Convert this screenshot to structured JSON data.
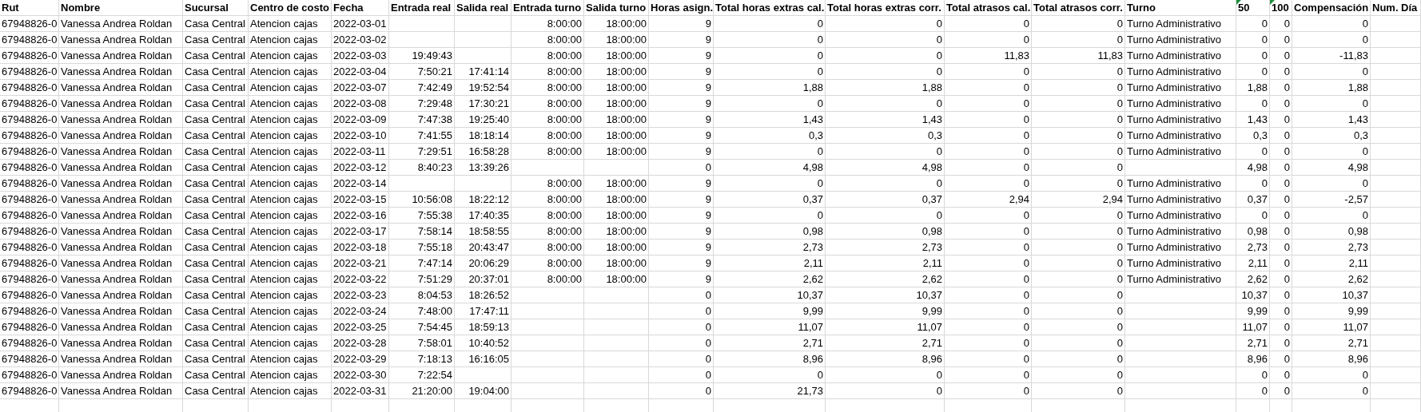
{
  "table": {
    "columns": [
      {
        "label": "Rut",
        "kind": "text"
      },
      {
        "label": "Nombre",
        "kind": "text"
      },
      {
        "label": "Sucursal",
        "kind": "text"
      },
      {
        "label": "Centro de costo",
        "kind": "text"
      },
      {
        "label": "Fecha",
        "kind": "text"
      },
      {
        "label": "Entrada real",
        "kind": "number"
      },
      {
        "label": "Salida real",
        "kind": "number"
      },
      {
        "label": "Entrada turno",
        "kind": "number"
      },
      {
        "label": "Salida turno",
        "kind": "number"
      },
      {
        "label": "Horas asign.",
        "kind": "number"
      },
      {
        "label": "Total horas extras cal.",
        "kind": "number"
      },
      {
        "label": "Total horas extras corr.",
        "kind": "number"
      },
      {
        "label": "Total atrasos cal.",
        "kind": "number"
      },
      {
        "label": "Total atrasos corr.",
        "kind": "number"
      },
      {
        "label": "Turno",
        "kind": "text"
      },
      {
        "label": "50",
        "kind": "number",
        "flagged": true
      },
      {
        "label": "100",
        "kind": "number",
        "flagged": true
      },
      {
        "label": "Compensación",
        "kind": "number"
      },
      {
        "label": "Num. Día",
        "kind": "text"
      }
    ],
    "rows": [
      [
        "67948826-0",
        "Vanessa Andrea Roldan",
        "Casa Central",
        "Atencion cajas",
        "2022-03-01",
        null,
        null,
        "8:00:00",
        "18:00:00",
        "9",
        "0",
        "0",
        "0",
        "0",
        "Turno Administrativo",
        "0",
        "0",
        "0",
        null
      ],
      [
        "67948826-0",
        "Vanessa Andrea Roldan",
        "Casa Central",
        "Atencion cajas",
        "2022-03-02",
        null,
        null,
        "8:00:00",
        "18:00:00",
        "9",
        "0",
        "0",
        "0",
        "0",
        "Turno Administrativo",
        "0",
        "0",
        "0",
        null
      ],
      [
        "67948826-0",
        "Vanessa Andrea Roldan",
        "Casa Central",
        "Atencion cajas",
        "2022-03-03",
        "19:49:43",
        null,
        "8:00:00",
        "18:00:00",
        "9",
        "0",
        "0",
        "11,83",
        "11,83",
        "Turno Administrativo",
        "0",
        "0",
        "-11,83",
        null
      ],
      [
        "67948826-0",
        "Vanessa Andrea Roldan",
        "Casa Central",
        "Atencion cajas",
        "2022-03-04",
        "7:50:21",
        "17:41:14",
        "8:00:00",
        "18:00:00",
        "9",
        "0",
        "0",
        "0",
        "0",
        "Turno Administrativo",
        "0",
        "0",
        "0",
        null
      ],
      [
        "67948826-0",
        "Vanessa Andrea Roldan",
        "Casa Central",
        "Atencion cajas",
        "2022-03-07",
        "7:42:49",
        "19:52:54",
        "8:00:00",
        "18:00:00",
        "9",
        "1,88",
        "1,88",
        "0",
        "0",
        "Turno Administrativo",
        "1,88",
        "0",
        "1,88",
        null
      ],
      [
        "67948826-0",
        "Vanessa Andrea Roldan",
        "Casa Central",
        "Atencion cajas",
        "2022-03-08",
        "7:29:48",
        "17:30:21",
        "8:00:00",
        "18:00:00",
        "9",
        "0",
        "0",
        "0",
        "0",
        "Turno Administrativo",
        "0",
        "0",
        "0",
        null
      ],
      [
        "67948826-0",
        "Vanessa Andrea Roldan",
        "Casa Central",
        "Atencion cajas",
        "2022-03-09",
        "7:47:38",
        "19:25:40",
        "8:00:00",
        "18:00:00",
        "9",
        "1,43",
        "1,43",
        "0",
        "0",
        "Turno Administrativo",
        "1,43",
        "0",
        "1,43",
        null
      ],
      [
        "67948826-0",
        "Vanessa Andrea Roldan",
        "Casa Central",
        "Atencion cajas",
        "2022-03-10",
        "7:41:55",
        "18:18:14",
        "8:00:00",
        "18:00:00",
        "9",
        "0,3",
        "0,3",
        "0",
        "0",
        "Turno Administrativo",
        "0,3",
        "0",
        "0,3",
        null
      ],
      [
        "67948826-0",
        "Vanessa Andrea Roldan",
        "Casa Central",
        "Atencion cajas",
        "2022-03-11",
        "7:29:51",
        "16:58:28",
        "8:00:00",
        "18:00:00",
        "9",
        "0",
        "0",
        "0",
        "0",
        "Turno Administrativo",
        "0",
        "0",
        "0",
        null
      ],
      [
        "67948826-0",
        "Vanessa Andrea Roldan",
        "Casa Central",
        "Atencion cajas",
        "2022-03-12",
        "8:40:23",
        "13:39:26",
        null,
        null,
        "0",
        "4,98",
        "4,98",
        "0",
        "0",
        null,
        "4,98",
        "0",
        "4,98",
        null
      ],
      [
        "67948826-0",
        "Vanessa Andrea Roldan",
        "Casa Central",
        "Atencion cajas",
        "2022-03-14",
        null,
        null,
        "8:00:00",
        "18:00:00",
        "9",
        "0",
        "0",
        "0",
        "0",
        "Turno Administrativo",
        "0",
        "0",
        "0",
        null
      ],
      [
        "67948826-0",
        "Vanessa Andrea Roldan",
        "Casa Central",
        "Atencion cajas",
        "2022-03-15",
        "10:56:08",
        "18:22:12",
        "8:00:00",
        "18:00:00",
        "9",
        "0,37",
        "0,37",
        "2,94",
        "2,94",
        "Turno Administrativo",
        "0,37",
        "0",
        "-2,57",
        null
      ],
      [
        "67948826-0",
        "Vanessa Andrea Roldan",
        "Casa Central",
        "Atencion cajas",
        "2022-03-16",
        "7:55:38",
        "17:40:35",
        "8:00:00",
        "18:00:00",
        "9",
        "0",
        "0",
        "0",
        "0",
        "Turno Administrativo",
        "0",
        "0",
        "0",
        null
      ],
      [
        "67948826-0",
        "Vanessa Andrea Roldan",
        "Casa Central",
        "Atencion cajas",
        "2022-03-17",
        "7:58:14",
        "18:58:55",
        "8:00:00",
        "18:00:00",
        "9",
        "0,98",
        "0,98",
        "0",
        "0",
        "Turno Administrativo",
        "0,98",
        "0",
        "0,98",
        null
      ],
      [
        "67948826-0",
        "Vanessa Andrea Roldan",
        "Casa Central",
        "Atencion cajas",
        "2022-03-18",
        "7:55:18",
        "20:43:47",
        "8:00:00",
        "18:00:00",
        "9",
        "2,73",
        "2,73",
        "0",
        "0",
        "Turno Administrativo",
        "2,73",
        "0",
        "2,73",
        null
      ],
      [
        "67948826-0",
        "Vanessa Andrea Roldan",
        "Casa Central",
        "Atencion cajas",
        "2022-03-21",
        "7:47:14",
        "20:06:29",
        "8:00:00",
        "18:00:00",
        "9",
        "2,11",
        "2,11",
        "0",
        "0",
        "Turno Administrativo",
        "2,11",
        "0",
        "2,11",
        null
      ],
      [
        "67948826-0",
        "Vanessa Andrea Roldan",
        "Casa Central",
        "Atencion cajas",
        "2022-03-22",
        "7:51:29",
        "20:37:01",
        "8:00:00",
        "18:00:00",
        "9",
        "2,62",
        "2,62",
        "0",
        "0",
        "Turno Administrativo",
        "2,62",
        "0",
        "2,62",
        null
      ],
      [
        "67948826-0",
        "Vanessa Andrea Roldan",
        "Casa Central",
        "Atencion cajas",
        "2022-03-23",
        "8:04:53",
        "18:26:52",
        null,
        null,
        "0",
        "10,37",
        "10,37",
        "0",
        "0",
        null,
        "10,37",
        "0",
        "10,37",
        null
      ],
      [
        "67948826-0",
        "Vanessa Andrea Roldan",
        "Casa Central",
        "Atencion cajas",
        "2022-03-24",
        "7:48:00",
        "17:47:11",
        null,
        null,
        "0",
        "9,99",
        "9,99",
        "0",
        "0",
        null,
        "9,99",
        "0",
        "9,99",
        null
      ],
      [
        "67948826-0",
        "Vanessa Andrea Roldan",
        "Casa Central",
        "Atencion cajas",
        "2022-03-25",
        "7:54:45",
        "18:59:13",
        null,
        null,
        "0",
        "11,07",
        "11,07",
        "0",
        "0",
        null,
        "11,07",
        "0",
        "11,07",
        null
      ],
      [
        "67948826-0",
        "Vanessa Andrea Roldan",
        "Casa Central",
        "Atencion cajas",
        "2022-03-28",
        "7:58:01",
        "10:40:52",
        null,
        null,
        "0",
        "2,71",
        "2,71",
        "0",
        "0",
        null,
        "2,71",
        "0",
        "2,71",
        null
      ],
      [
        "67948826-0",
        "Vanessa Andrea Roldan",
        "Casa Central",
        "Atencion cajas",
        "2022-03-29",
        "7:18:13",
        "16:16:05",
        null,
        null,
        "0",
        "8,96",
        "8,96",
        "0",
        "0",
        null,
        "8,96",
        "0",
        "8,96",
        null
      ],
      [
        "67948826-0",
        "Vanessa Andrea Roldan",
        "Casa Central",
        "Atencion cajas",
        "2022-03-30",
        "7:22:54",
        null,
        null,
        null,
        "0",
        "0",
        "0",
        "0",
        "0",
        null,
        "0",
        "0",
        "0",
        null
      ],
      [
        "67948826-0",
        "Vanessa Andrea Roldan",
        "Casa Central",
        "Atencion cajas",
        "2022-03-31",
        "21:20:00",
        "19:04:00",
        null,
        null,
        "0",
        "21,73",
        "0",
        "0",
        "0",
        null,
        "0",
        "0",
        "0",
        null
      ]
    ]
  }
}
